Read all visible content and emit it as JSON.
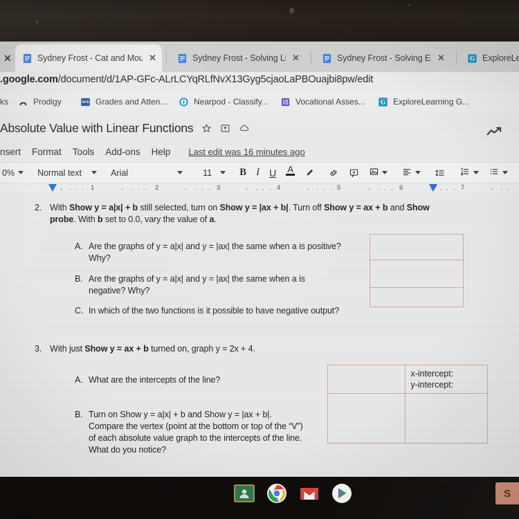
{
  "browser": {
    "tabs": [
      {
        "label": "Sydney Frost - Cat and Mouse",
        "favicon": "google-docs-icon",
        "active": true,
        "close_label": "✕"
      },
      {
        "label": "Sydney Frost - Solving Linear",
        "favicon": "google-docs-icon",
        "active": false,
        "close_label": "✕"
      },
      {
        "label": "Sydney Frost - Solving Equatio",
        "favicon": "google-docs-icon",
        "active": false,
        "close_label": "✕"
      },
      {
        "label": "ExploreLearn",
        "favicon": "gizmos-g-icon",
        "active": false,
        "close_label": ""
      }
    ],
    "left_close_label": "✕",
    "url_prefix": ".google.com",
    "url_rest": "/document/d/1AP-GFc-ALrLCYqRLfNvX13Gyg5cjaoLaPBOuajbi8pw/edit",
    "bookmarks_label": "ks",
    "bookmarks": [
      {
        "label": "Prodigy",
        "icon": "prodigy-icon"
      },
      {
        "label": "Grades and Atten...",
        "icon": "grades-icon"
      },
      {
        "label": "Nearpod - Classify...",
        "icon": "nearpod-icon"
      },
      {
        "label": "Vocational Asses...",
        "icon": "vocational-icon"
      },
      {
        "label": "ExploreLearning G...",
        "icon": "gizmos-g-icon"
      }
    ]
  },
  "docs": {
    "title": "Absolute Value with Linear Functions",
    "title_icons": [
      "star-icon",
      "move-to-folder-icon",
      "cloud-saved-icon"
    ],
    "explore_icon": "explore-trend-icon",
    "menus": [
      "nsert",
      "Format",
      "Tools",
      "Add-ons",
      "Help"
    ],
    "last_edit": "Last edit was 16 minutes ago",
    "toolbar": {
      "zoom": "0%",
      "style": "Normal text",
      "font": "Arial",
      "size": "11",
      "bold": "B",
      "italic": "I",
      "underline": "U",
      "text_color": "A",
      "highlight_icon": "highlight-pen-icon",
      "link_icon": "insert-link-icon",
      "comment_icon": "add-comment-icon",
      "image_icon": "insert-image-icon",
      "align_icon": "align-left-icon",
      "line_spacing_icon": "line-spacing-icon",
      "numbered_list_icon": "numbered-list-icon",
      "bulleted_list_icon": "bulleted-list-icon",
      "indent_icon": "decrease-indent-icon"
    },
    "ruler": {
      "numbers": [
        "1",
        "2",
        "3",
        "4",
        "5",
        "6",
        "7"
      ]
    }
  },
  "document": {
    "q2": {
      "number": "2.",
      "line1_a": "With ",
      "line1_b": "Show y = a|x| + b",
      "line1_c": " still selected, turn on ",
      "line1_d": "Show y = |ax + b|",
      "line1_e": ". Turn off ",
      "line1_f": "Show y = ax + b",
      "line1_g": " and ",
      "line1_h": "Show",
      "line2_a": "probe",
      "line2_b": ". With ",
      "line2_c": "b",
      "line2_d": " set to 0.0, vary the value of ",
      "line2_e": "a",
      "line2_f": ".",
      "items": [
        {
          "letter": "A.",
          "line1": "Are the graphs of y = a|x| and y = |ax| the same when a is positive?",
          "line2": "Why?"
        },
        {
          "letter": "B.",
          "line1": "Are the graphs of y = a|x| and y = |ax| the same when a is",
          "line2": "negative? Why?"
        },
        {
          "letter": "C.",
          "line1": "In which of the two functions is it possible to have negative output?",
          "line2": ""
        }
      ],
      "answer_table_rows": [
        "",
        "",
        ""
      ]
    },
    "q3": {
      "number": "3.",
      "line1_a": "With just ",
      "line1_b": "Show y = ax + b",
      "line1_c": " turned on, graph y = 2x + 4.",
      "items": [
        {
          "letter": "A.",
          "lines": [
            "What are the intercepts of the line?"
          ]
        },
        {
          "letter": "B.",
          "lines": [
            "Turn on Show y = a|x| + b and Show y = |ax + b|.",
            "Compare the vertex (point at the bottom or top of the “V”)",
            "of each absolute value graph to the intercepts of the line.",
            "What do you notice?"
          ]
        }
      ],
      "answer_table": [
        [
          "",
          "x-intercept:\ny-intercept:"
        ],
        [
          "",
          ""
        ]
      ]
    }
  },
  "shelf": {
    "icons": [
      {
        "name": "google-classroom-icon"
      },
      {
        "name": "chrome-icon"
      },
      {
        "name": "gmail-icon"
      },
      {
        "name": "play-store-icon"
      }
    ],
    "right_button_label": "S"
  },
  "colors": {
    "table_border": "#d9a98c",
    "accent_blue": "#2a6fd4",
    "shelf_bg": "#100d0b",
    "bezel": "#241d18"
  }
}
